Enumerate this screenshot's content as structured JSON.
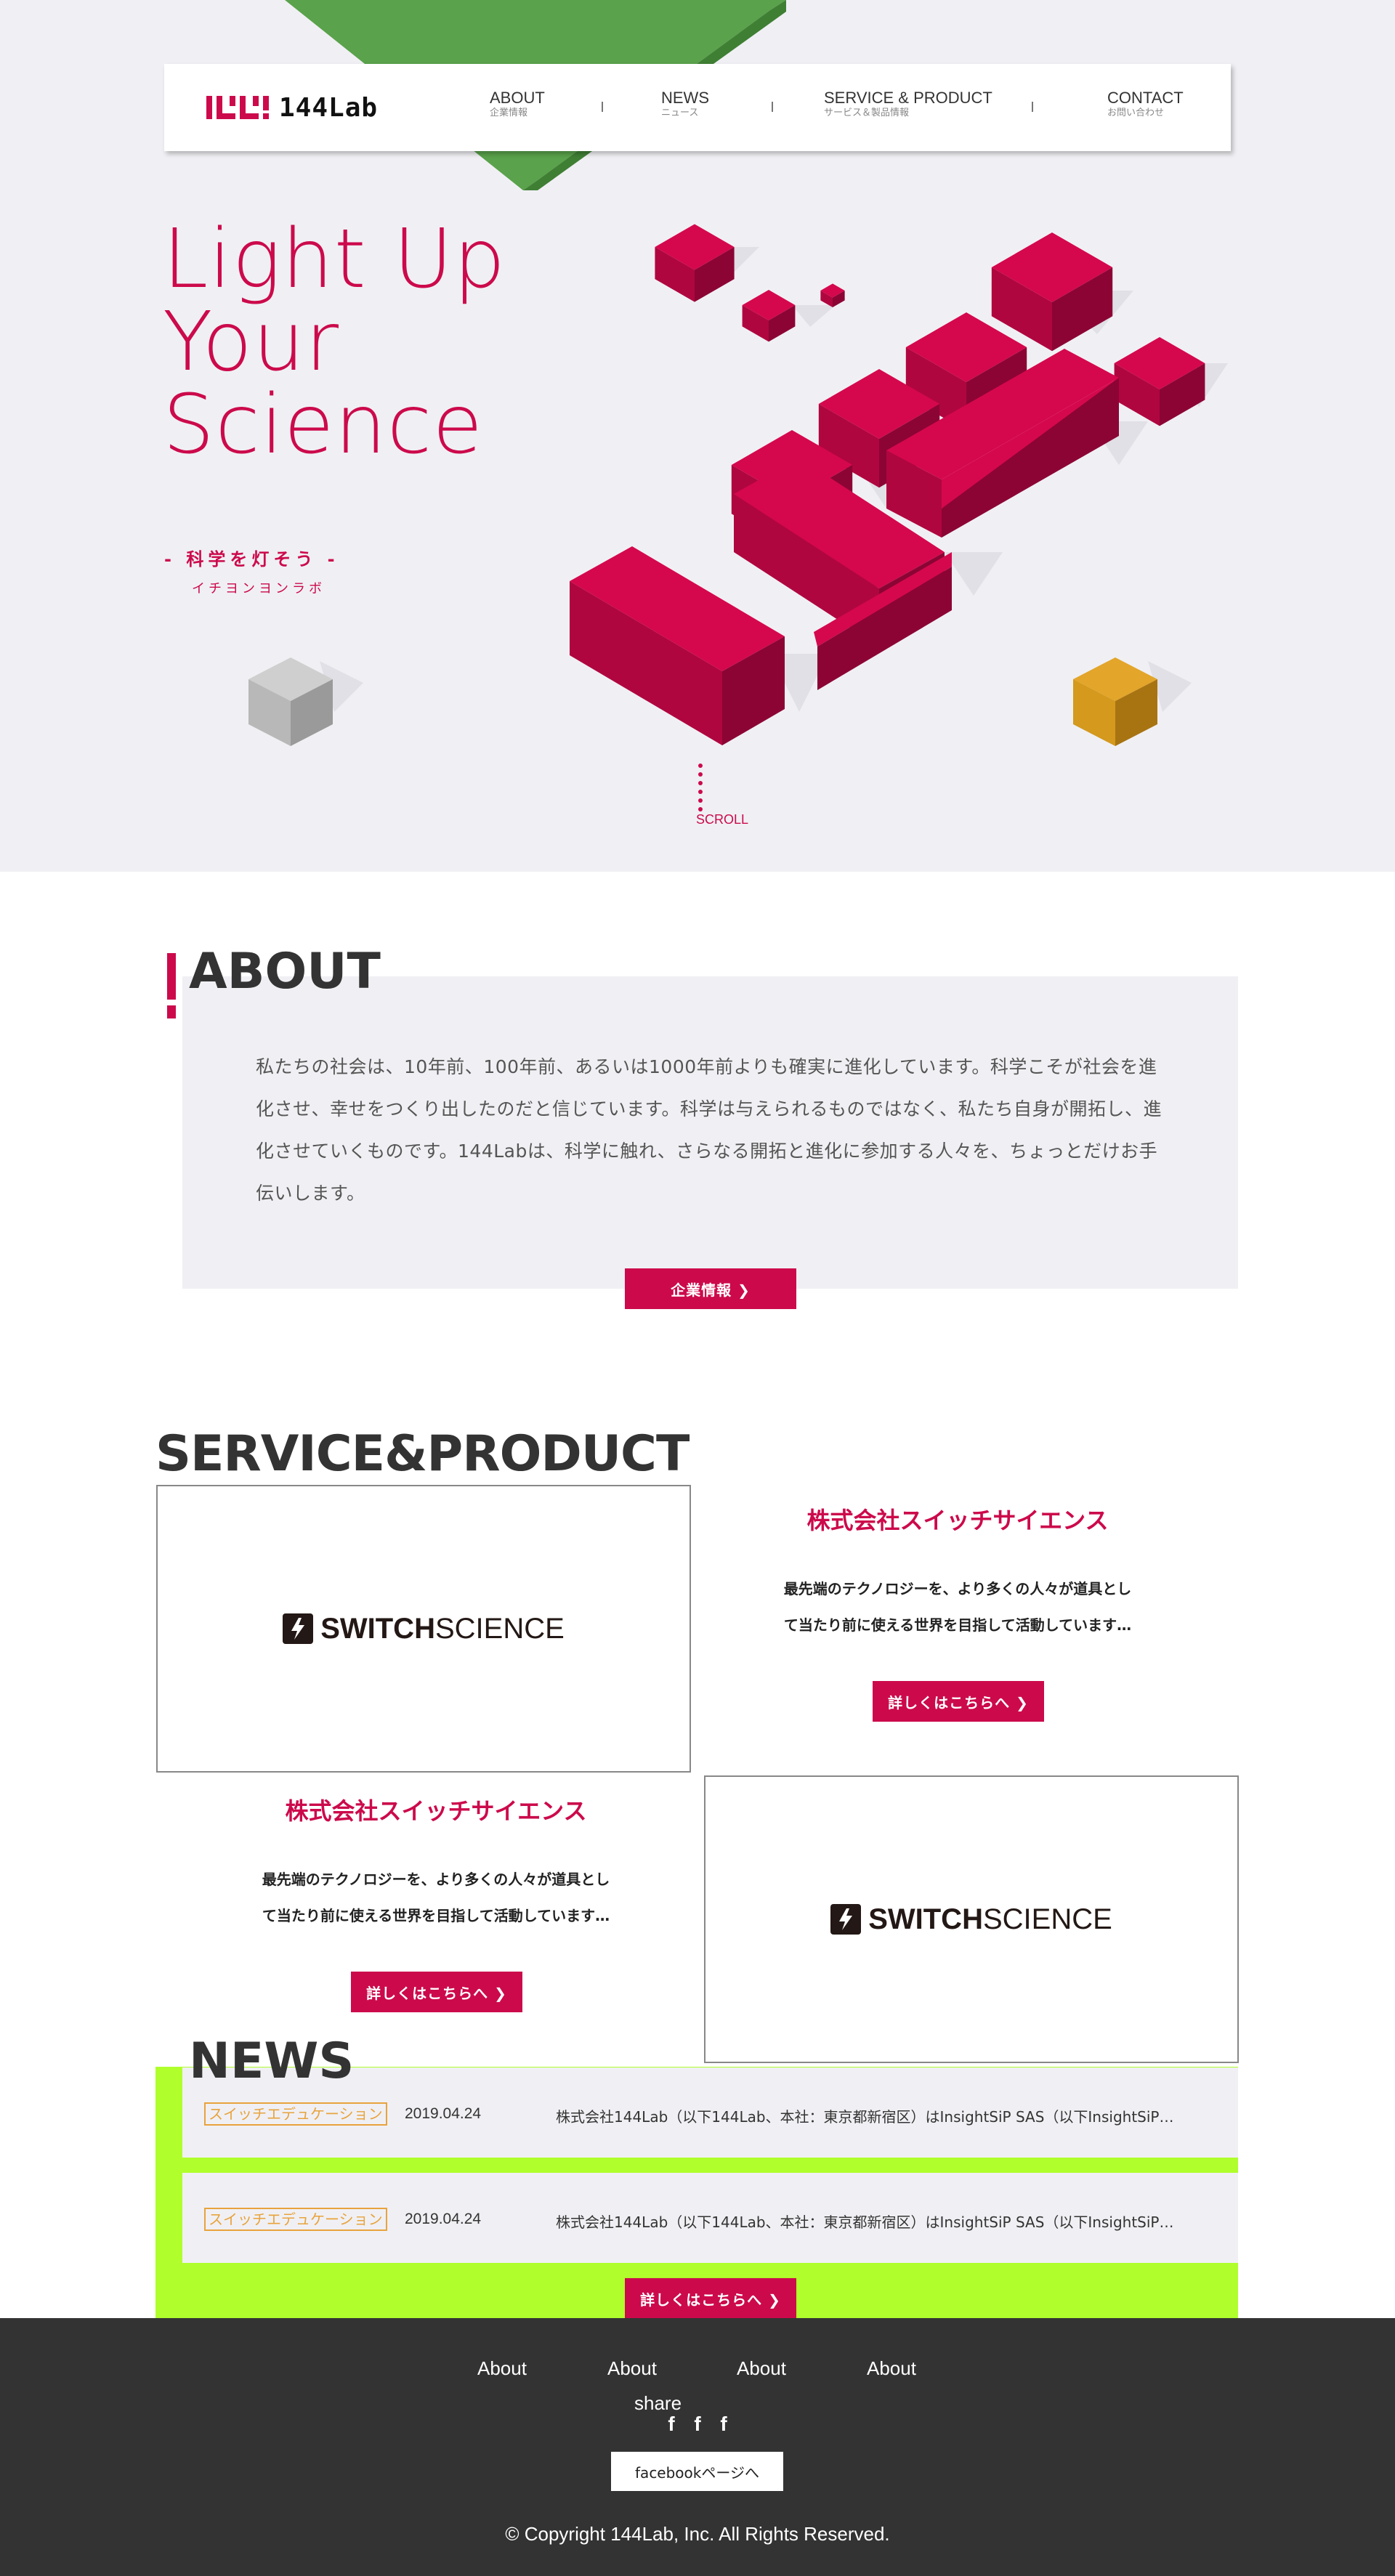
{
  "brand": {
    "logo_text": "144Lab",
    "accent": "#cc0a4b",
    "green": "#5aa24b",
    "lime": "#b0ff2c",
    "gold": "#d4991d"
  },
  "nav": [
    {
      "en": "ABOUT",
      "jp": "企業情報"
    },
    {
      "en": "NEWS",
      "jp": "ニュース"
    },
    {
      "en": "SERVICE & PRODUCT",
      "jp": "サービス＆製品情報"
    },
    {
      "en": "CONTACT",
      "jp": "お問い合わせ"
    }
  ],
  "hero": {
    "title": "Light Up\nYour\nScience",
    "subtitle": "- 科学を灯そう -",
    "reading": "イチヨンヨンラボ",
    "scroll": "SCROLL"
  },
  "about": {
    "title": "ABOUT",
    "text": "私たちの社会は、10年前、100年前、あるいは1000年前よりも確実に進化しています。科学こそが社会を進化させ、幸せをつくり出したのだと信じています。科学は与えられるものではなく、私たち自身が開拓し、進化させていくものです。144Labは、科学に触れ、さらなる開拓と進化に参加する人々を、ちょっとだけお手伝いします。",
    "button": "企業情報 ❯"
  },
  "service": {
    "title": "SERVICE&PRODUCT",
    "items": [
      {
        "logo_bold": "SWITCH",
        "logo_light": "SCIENCE",
        "name": "株式会社スイッチサイエンス",
        "desc_1": "最先端のテクノロジーを、より多くの人々が道具とし",
        "desc_2": "て当たり前に使える世界を目指して活動しています…",
        "button": "詳しくはこちらへ ❯"
      },
      {
        "logo_bold": "SWITCH",
        "logo_light": "SCIENCE",
        "name": "株式会社スイッチサイエンス",
        "desc_1": "最先端のテクノロジーを、より多くの人々が道具とし",
        "desc_2": "て当たり前に使える世界を目指して活動しています…",
        "button": "詳しくはこちらへ ❯"
      }
    ]
  },
  "news": {
    "title": "NEWS",
    "items": [
      {
        "tag": "スイッチエデュケーション",
        "date": "2019.04.24",
        "headline": "株式会社144Lab（以下144Lab、本社：東京都新宿区）はInsightSiP SAS（以下InsightSiP…"
      },
      {
        "tag": "スイッチエデュケーション",
        "date": "2019.04.24",
        "headline": "株式会社144Lab（以下144Lab、本社：東京都新宿区）はInsightSiP SAS（以下InsightSiP…"
      }
    ],
    "button": "詳しくはこちらへ ❯"
  },
  "footer": {
    "links": [
      "About",
      "About",
      "About",
      "About"
    ],
    "share": "share",
    "fb_icons": [
      "f",
      "f",
      "f"
    ],
    "fb_button": "facebookページへ",
    "copyright": "© Copyright 144Lab, Inc. All Rights Reserved."
  }
}
